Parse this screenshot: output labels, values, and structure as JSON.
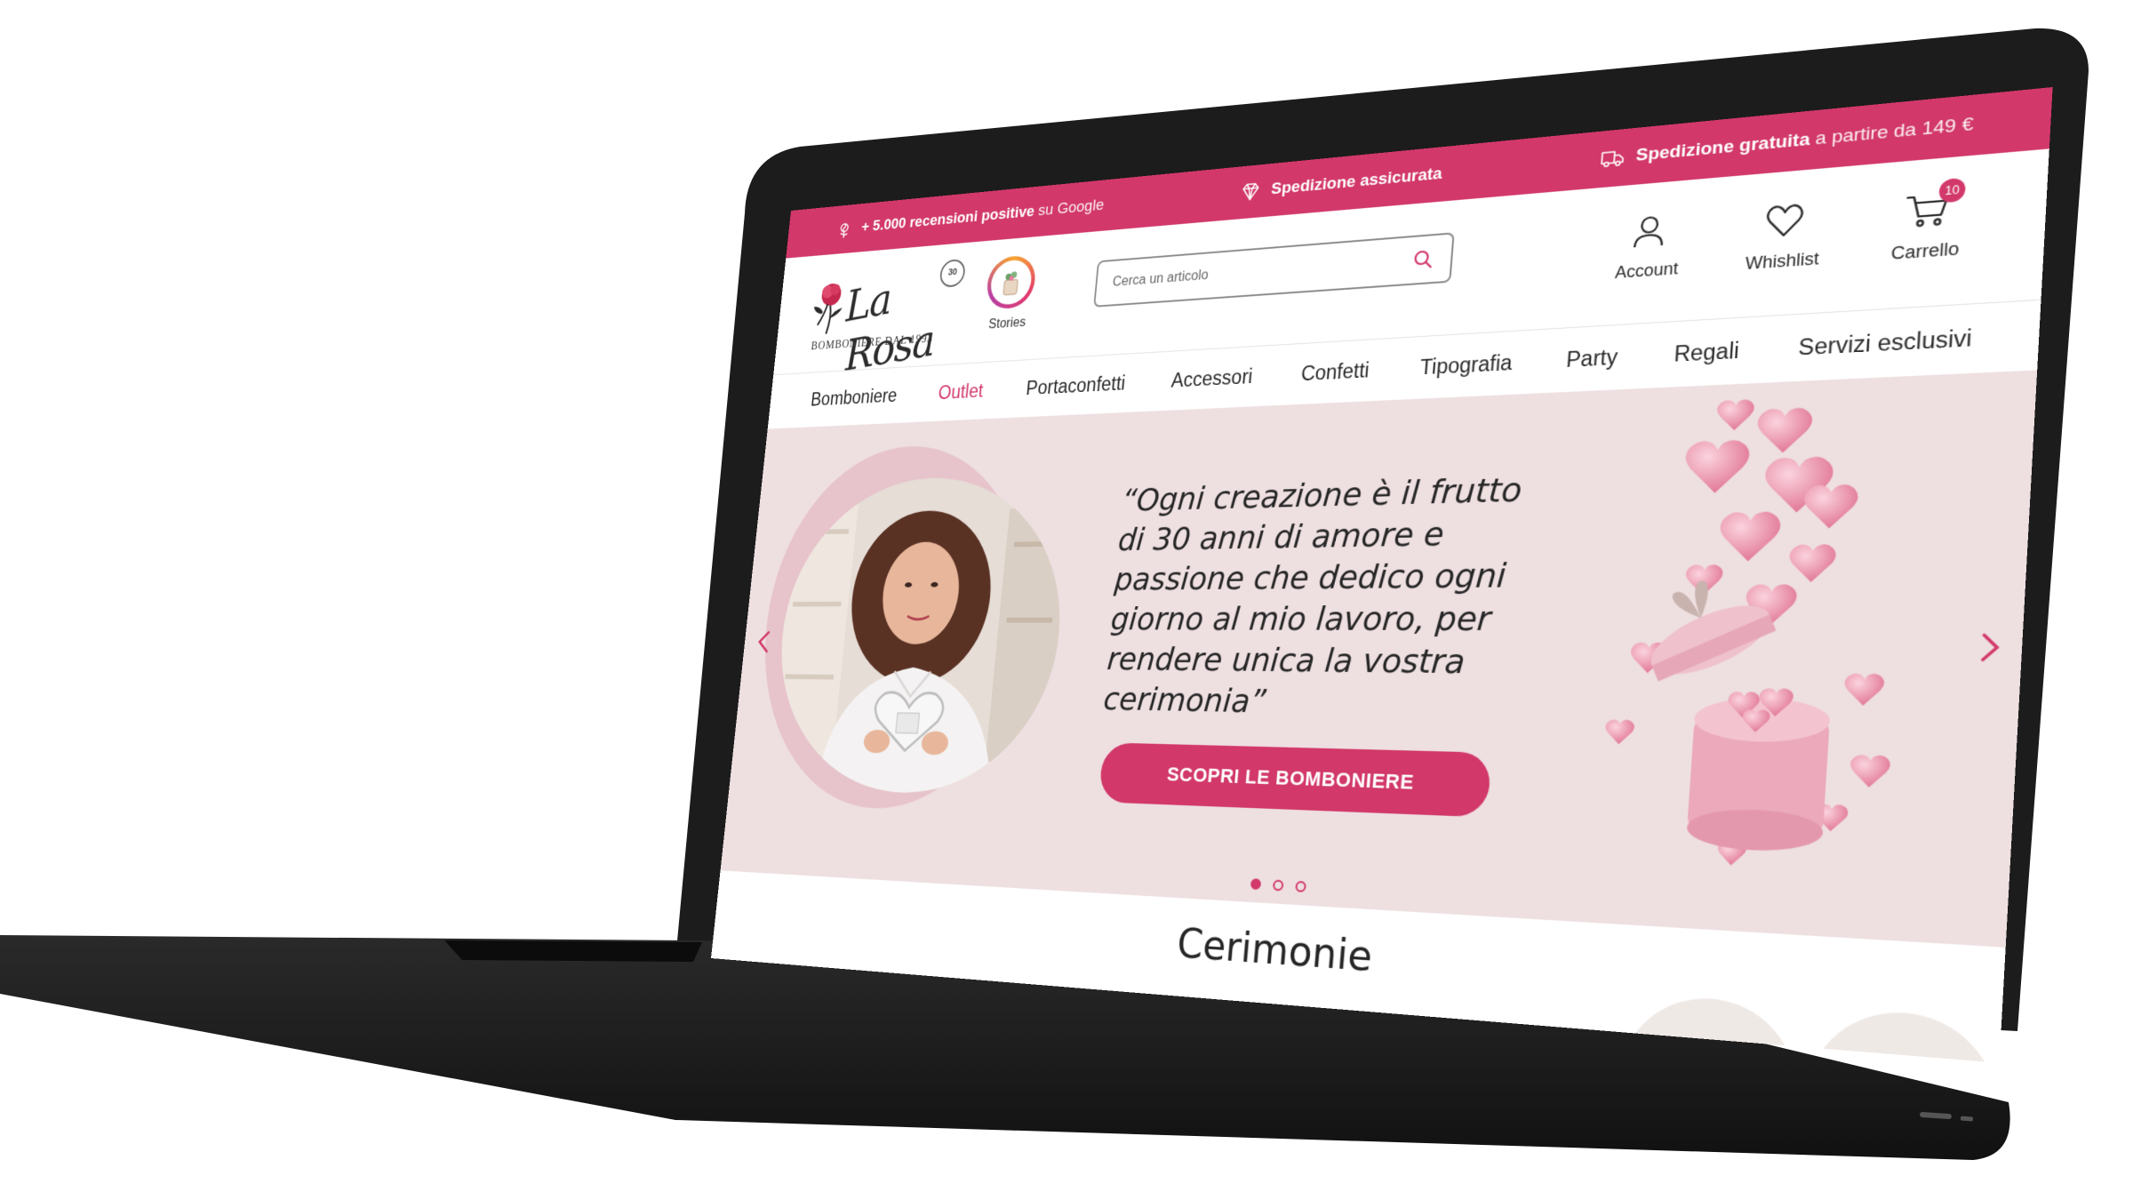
{
  "promo_bar": {
    "reviews_bold": "+ 5.000 recensioni positive",
    "reviews_rest": "su Google",
    "shipping_insured": "Spedizione assicurata",
    "free_shipping_bold": "Spedizione gratuita",
    "free_shipping_rest": "a partire da 149 €"
  },
  "header": {
    "logo_script": "La Rosa",
    "logo_sub": "BOMBONIERE DAL 1993",
    "logo_badge": "30",
    "stories_label": "Stories",
    "search_placeholder": "Cerca un articolo",
    "account_label": "Account",
    "wishlist_label": "Whishlist",
    "cart_label": "Carrello",
    "cart_count": "10"
  },
  "nav": {
    "items": [
      {
        "label": "Bomboniere"
      },
      {
        "label": "Outlet"
      },
      {
        "label": "Portaconfetti"
      },
      {
        "label": "Accessori"
      },
      {
        "label": "Confetti"
      },
      {
        "label": "Tipografia"
      },
      {
        "label": "Party"
      },
      {
        "label": "Regali"
      },
      {
        "label": "Servizi esclusivi"
      }
    ],
    "active_index": 1
  },
  "hero": {
    "quote": "“Ogni creazione è il frutto di 30 anni di amore e passione che dedico ogni giorno al mio lavoro, per rendere unica la vostra cerimonia”",
    "cta_label": "SCOPRI LE BOMBONIERE",
    "slide_count": 3,
    "active_slide": 0
  },
  "section": {
    "title": "Cerimonie"
  },
  "colors": {
    "accent": "#d2386a",
    "hero_bg": "#eedfe1",
    "laptop_body": "#1c1c1c"
  },
  "icons": {
    "reviews": "rose-icon",
    "shipping_insured": "diamond-icon",
    "free_shipping": "truck-icon",
    "search": "search-icon",
    "account": "user-icon",
    "wishlist": "heart-icon",
    "cart": "cart-icon",
    "prev": "chevron-left-icon",
    "next": "chevron-right-icon"
  }
}
